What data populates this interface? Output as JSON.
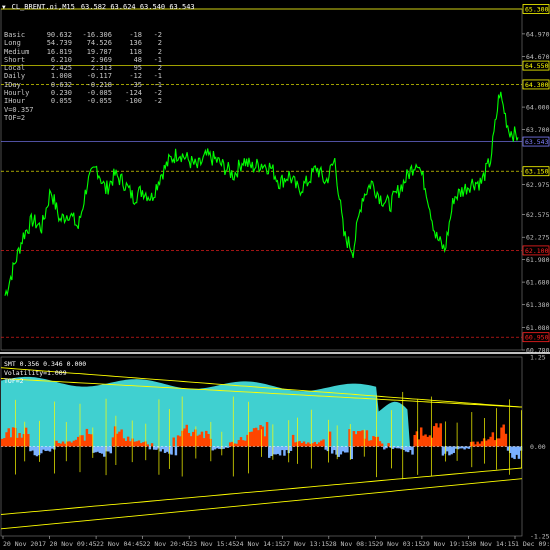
{
  "window": {
    "title": "CL_BRENT.oi,M15",
    "ohlc": "63.582 63.624 63.540 63.543"
  },
  "stats": [
    [
      "Basic",
      "90.632",
      "-16.306",
      "-18",
      "-2"
    ],
    [
      "Long",
      "54.739",
      "74.526",
      "136",
      "2"
    ],
    [
      "Medium",
      "16.819",
      "19.787",
      "118",
      "2"
    ],
    [
      "Short",
      "6.210",
      "2.969",
      "48",
      "-1"
    ],
    [
      "Local",
      "2.425",
      "2.313",
      "95",
      "2"
    ],
    [
      "Daily",
      "1.008",
      "-0.117",
      "-12",
      "-1"
    ],
    [
      "IDay",
      "0.632",
      "-0.218",
      "-35",
      "-1"
    ],
    [
      "Hourly",
      "0.230",
      "-0.085",
      "-124",
      "-2"
    ],
    [
      "IHour",
      "0.055",
      "-0.055",
      "-100",
      "-2"
    ]
  ],
  "stat_footer": [
    "V=0.357",
    "TOF=2"
  ],
  "price_axis": {
    "ticks": [
      "64.970",
      "64.670",
      "64.000",
      "63.700",
      "62.975",
      "62.575",
      "62.275",
      "61.980",
      "61.680",
      "61.380",
      "61.080",
      "60.780"
    ],
    "tick_values": [
      64.97,
      64.67,
      64.0,
      63.7,
      62.975,
      62.575,
      62.275,
      61.98,
      61.68,
      61.38,
      61.08,
      60.78
    ],
    "ymin": 60.78,
    "ymax": 65.3
  },
  "level_labels": [
    {
      "text": "65.300",
      "value": 65.3,
      "color": "#ffff00",
      "style": "solid"
    },
    {
      "text": "64.550",
      "value": 64.55,
      "color": "#ffff00",
      "style": "solid"
    },
    {
      "text": "64.300",
      "value": 64.3,
      "color": "#ffff00",
      "style": "dashed"
    },
    {
      "text": "63.543",
      "value": 63.543,
      "color": "#8080ff",
      "style": "solid"
    },
    {
      "text": "63.150",
      "value": 63.15,
      "color": "#ffff00",
      "style": "dashed"
    },
    {
      "text": "62.100",
      "value": 62.1,
      "color": "#ff2020",
      "style": "dashed"
    },
    {
      "text": "60.950",
      "value": 60.95,
      "color": "#ff2020",
      "style": "dashed"
    }
  ],
  "indicator": {
    "title": "SMT 0.356 0.346 0.000",
    "line2": "Volatility=1.009",
    "line3": "TOF=2",
    "axis": [
      "1.25",
      "0.00",
      "-1.25"
    ],
    "ymin": -1.25,
    "ymax": 1.25
  },
  "time_axis": [
    "20 Nov 2017",
    "20 Nov 09:45",
    "22 Nov 04:45",
    "22 Nov 20:45",
    "23 Nov 15:45",
    "24 Nov 14:15",
    "27 Nov 13:15",
    "28 Nov 08:15",
    "29 Nov 03:15",
    "29 Nov 19:15",
    "30 Nov 14:15",
    "1 Dec 09:15"
  ],
  "colors": {
    "price": "#00ff00",
    "area": "#40d0d0",
    "hist_red": "#ff4500",
    "hist_blue": "#7ab0ff",
    "yellow": "#ffff00",
    "grid_sep": "#ffffff"
  },
  "chart_data": {
    "type": "line",
    "series": [
      {
        "values": [
          61.5,
          61.9,
          62.3,
          62.5,
          62.4,
          62.9,
          62.5,
          62.6,
          62.4,
          63.0,
          63.2,
          62.9,
          63.1,
          63.0,
          62.8,
          62.9,
          62.8,
          63.1,
          63.3,
          63.4,
          63.3,
          63.2,
          63.35,
          63.3,
          63.2,
          63.1,
          63.3,
          63.2,
          63.25,
          63.2,
          63.0,
          63.1,
          62.9,
          63.0,
          63.2,
          63.0,
          63.3,
          62.3,
          62.1,
          62.8,
          63.0,
          62.8,
          62.7,
          62.9,
          63.1,
          63.3,
          62.9,
          62.3,
          62.1,
          62.8,
          62.9,
          63.0,
          63.0,
          63.3,
          64.2,
          63.7,
          63.6
        ]
      }
    ],
    "ylim": [
      60.78,
      65.3
    ]
  }
}
